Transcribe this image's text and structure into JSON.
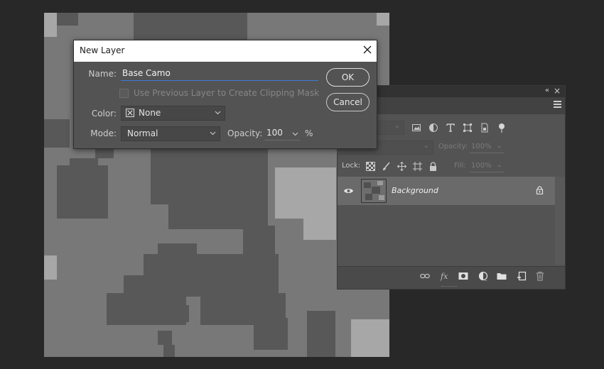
{
  "dialog": {
    "title": "New Layer",
    "name_label": "Name:",
    "name_value": "Base Camo",
    "clipping_label": "Use Previous Layer to Create Clipping Mask",
    "color_label": "Color:",
    "color_value": "None",
    "mode_label": "Mode:",
    "mode_value": "Normal",
    "opacity_label": "Opacity:",
    "opacity_value": "100",
    "opacity_unit": "%",
    "ok_label": "OK",
    "cancel_label": "Cancel"
  },
  "layers_panel": {
    "opacity_label": "Opacity:",
    "opacity_value": "100%",
    "lock_label": "Lock:",
    "fill_label": "Fill:",
    "fill_value": "100%",
    "layers": [
      {
        "name": "Background",
        "visible": true,
        "locked": true
      }
    ]
  },
  "colors": {
    "app_background": "#282828",
    "panel": "#535353",
    "selected_layer_row": "#6a6a6a",
    "dialog_titlebar": "#ffffff",
    "name_underline": "#3d7ad6",
    "camo_dark": "#585858",
    "camo_mid": "#787878",
    "camo_light": "#a7a7a7"
  }
}
